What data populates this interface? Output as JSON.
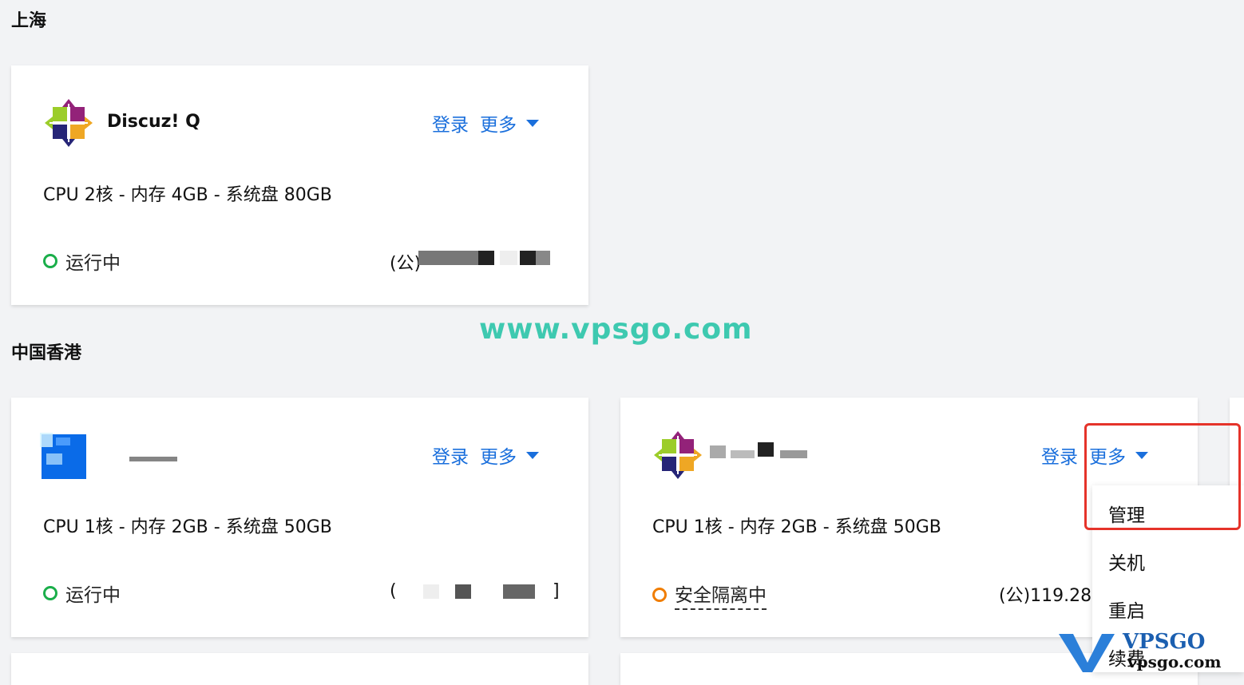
{
  "regions": {
    "shanghai": "上海",
    "hongkong": "中国香港"
  },
  "actions": {
    "login": "登录",
    "more": "更多"
  },
  "cards": [
    {
      "name": "Discuz! Q",
      "spec": "CPU 2核 - 内存 4GB - 系统盘 80GB",
      "status": "运行中",
      "ip": "(公)"
    },
    {
      "name": "",
      "spec": "CPU 1核 - 内存 2GB - 系统盘 50GB",
      "status": "运行中",
      "ip": "(",
      "ip_end": "]"
    },
    {
      "name": "",
      "spec": "CPU 1核 - 内存 2GB - 系统盘 50GB",
      "status": "安全隔离中",
      "ip": "(公)119.28."
    }
  ],
  "dropdown": {
    "items": [
      "管理",
      "关机",
      "重启",
      "续费"
    ]
  },
  "watermark": "www.vpsgo.com",
  "logo": {
    "main": "VPSGO",
    "sub": "vpsgo.com"
  },
  "colors": {
    "link": "#1a6fdc",
    "running": "#1aae4a",
    "isolated": "#f07d00",
    "highlight": "#e5332a",
    "watermark": "#3ec9b0"
  }
}
